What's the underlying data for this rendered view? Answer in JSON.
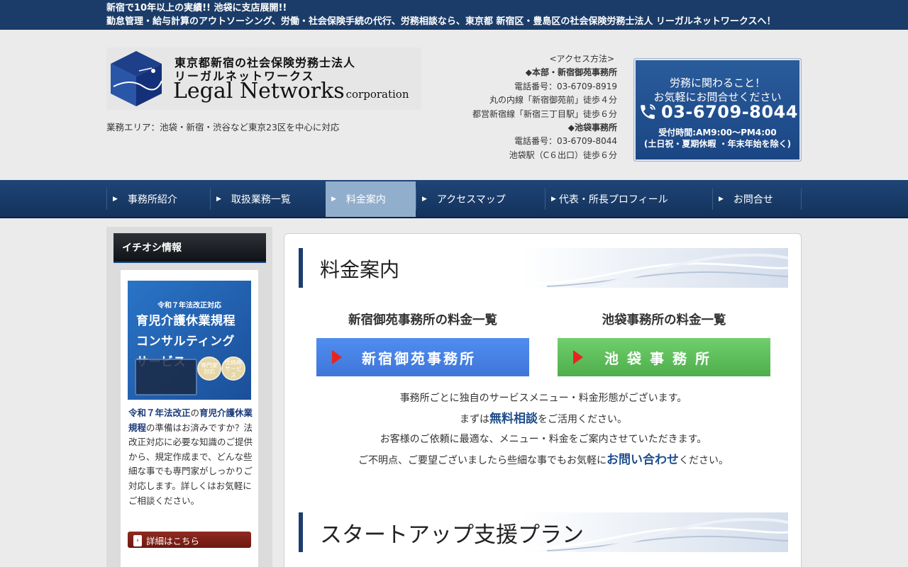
{
  "topbar": {
    "line1": "新宿で10年以上の実績!! 池袋に支店展開!!",
    "line2": "勤怠管理・給与計算のアウトソーシング、労働・社会保険手続の代行、労務相談なら、東京都 新宿区・豊島区の社会保険労務士法人 リーガルネットワークスへ！"
  },
  "logo": {
    "jp_line1": "東京都新宿の社会保険労務士法人",
    "jp_line2": "リーガルネットワークス",
    "en_name": "Legal Networks",
    "en_suffix": "corporation"
  },
  "area_text": "業務エリア：池袋・新宿・渋谷など東京23区を中心に対応",
  "access": {
    "title": "<アクセス方法>",
    "office1_name": "◆本部・新宿御苑事務所",
    "office1_phone": "電話番号：03-6709-8919",
    "office1_route1": "丸の内線「新宿御苑前」徒歩４分",
    "office1_route2": "都営新宿線「新宿三丁目駅」徒歩６分",
    "office2_name": "◆池袋事務所",
    "office2_phone": "電話番号：03-6709-8044",
    "office2_route1": "池袋駅（C６出口）徒歩６分"
  },
  "phonebox": {
    "line1": "労務に関わること！",
    "line2": "お気軽にお問合せください",
    "phone": "03-6709-8044",
    "hours": "受付時間:AM9:00〜PM4:00",
    "closed": "(土日祝・夏期休暇 ・年末年始を除く)"
  },
  "nav": {
    "items": [
      {
        "label": "事務所紹介"
      },
      {
        "label": "取扱業務一覧"
      },
      {
        "label": "料金案内"
      },
      {
        "label": "アクセスマップ"
      },
      {
        "label": "代表・所長プロフィール"
      },
      {
        "label": "お問合せ"
      }
    ],
    "active": "料金案内"
  },
  "sidebar": {
    "heading": "イチオシ情報",
    "promo_sub": "令和７年法改正対応",
    "promo_line1": "育児介護休業規程",
    "promo_line2": "コンサルティング",
    "promo_line3": "サービス",
    "badge1": "専門家対応",
    "badge2": "低価格サービス",
    "text_part1": "令和７年法改正",
    "text_part2": "の",
    "text_part3": "育児介護休業規程",
    "text_part4": "の準備はお済みですか？法改正対応に必要な知識のご提供から、規定作成まで、どんな些細な事でも専門家がしっかりご対応します。詳しくはお気軽にご相談ください。",
    "button": "詳細はこちら"
  },
  "main": {
    "section1_title": "料金案内",
    "office1_heading": "新宿御苑事務所の料金一覧",
    "office2_heading": "池袋事務所の料金一覧",
    "office1_button": "新宿御苑事務所",
    "office2_button": "池袋事務所",
    "intro_line1": "事務所ごとに独自のサービスメニュー・料金形態がございます。",
    "intro_line2_pre": "まずは",
    "intro_line2_em": "無料相談",
    "intro_line2_post": "をご活用ください。",
    "intro_line3": "お客様のご依頼に最適な、メニュー・料金をご案内させていただきます。",
    "intro_line4_pre": "ご不明点、ご要望ございましたら些細な事でもお気軽に",
    "intro_line4_em": "お問い合わせ",
    "intro_line4_post": "ください。",
    "section2_title": "スタートアップ支援プラン"
  },
  "colors": {
    "navy": "#1b3c68",
    "nav_active": "#92aecd",
    "phonebox": "#1a4583",
    "blue_button": "#4f8df0",
    "green_button": "#6fcf6c",
    "side_button": "#8f2a20"
  }
}
